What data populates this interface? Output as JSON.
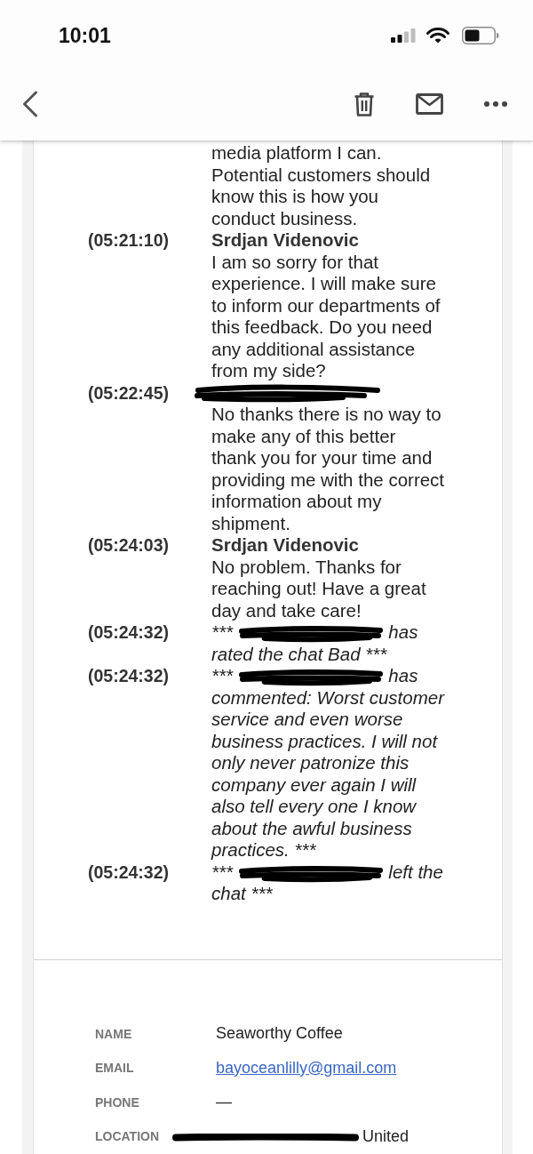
{
  "status_bar": {
    "time": "10:01"
  },
  "transcript": [
    {
      "kind": "message",
      "text": "media platform I can. Potential customers should know this is how you conduct business."
    },
    {
      "kind": "message",
      "time": "(05:21:10)",
      "sender": "Srdjan Videnovic",
      "sender_redacted": false,
      "text": "I am so sorry for that experience. I will make sure to inform our departments of this feedback. Do you need any additional assistance from my side?"
    },
    {
      "kind": "message",
      "time": "(05:22:45)",
      "sender_redacted": true,
      "text": "No thanks there is no way to make any of this better thank you for your time and providing me with the correct information about my shipment."
    },
    {
      "kind": "message",
      "time": "(05:24:03)",
      "sender": "Srdjan Videnovic",
      "sender_redacted": false,
      "text": "No problem. Thanks for reaching out! Have a great day and take care!"
    },
    {
      "kind": "event",
      "time": "(05:24:32)",
      "prefix": "***",
      "name_redacted": true,
      "text": "has rated the chat Bad ***"
    },
    {
      "kind": "event",
      "time": "(05:24:32)",
      "prefix": "***",
      "name_redacted": true,
      "text": "has commented: Worst customer service and even worse business practices. I will not only never patronize this company ever again I will also tell every one I know about the awful business practices. ***"
    },
    {
      "kind": "event",
      "time": "(05:24:32)",
      "prefix": "***",
      "name_redacted": true,
      "text": "left the chat ***"
    }
  ],
  "contact": [
    {
      "label": "NAME",
      "kind": "text",
      "value": "Seaworthy Coffee"
    },
    {
      "label": "EMAIL",
      "kind": "link",
      "value": "bayoceanlilly@gmail.com"
    },
    {
      "label": "PHONE",
      "kind": "text",
      "value": "—"
    },
    {
      "label": "LOCATION",
      "kind": "text",
      "value": "United",
      "redacted": true
    }
  ]
}
